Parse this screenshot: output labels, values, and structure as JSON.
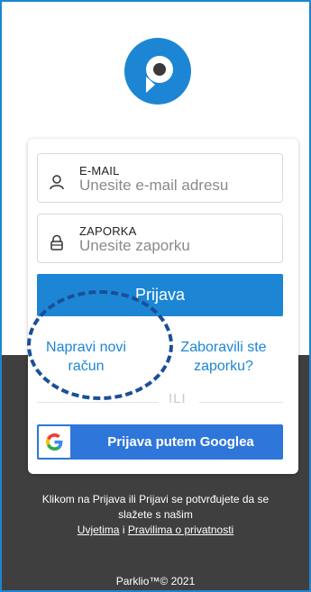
{
  "logo": {
    "icon": "parklio-logo-icon",
    "color": "#1c86d4"
  },
  "form": {
    "email": {
      "label": "E-MAIL",
      "placeholder": "Unesite e-mail adresu",
      "icon": "user-icon"
    },
    "password": {
      "label": "ZAPORKA",
      "placeholder": "Unesite zaporku",
      "icon": "lock-icon"
    },
    "login_button": "Prijava",
    "create_account": "Napravi novi račun",
    "forgot_password": "Zaboravili ste zaporku?",
    "divider": "ILI",
    "google_button": "Prijava putem Googlea"
  },
  "terms": {
    "line1": "Klikom na Prijava ili Prijavi se potvrđujete da se",
    "line2": "slažete s našim",
    "terms_link": "Uvjetima",
    "connector": "i",
    "privacy_link": "Pravilima o privatnosti"
  },
  "footer": {
    "copyright": "Parklio™© 2021"
  },
  "colors": {
    "accent": "#1c86d4",
    "google_button": "#2e76d9",
    "background_dark": "#3f3f3f",
    "annotation": "#1a4f98"
  }
}
